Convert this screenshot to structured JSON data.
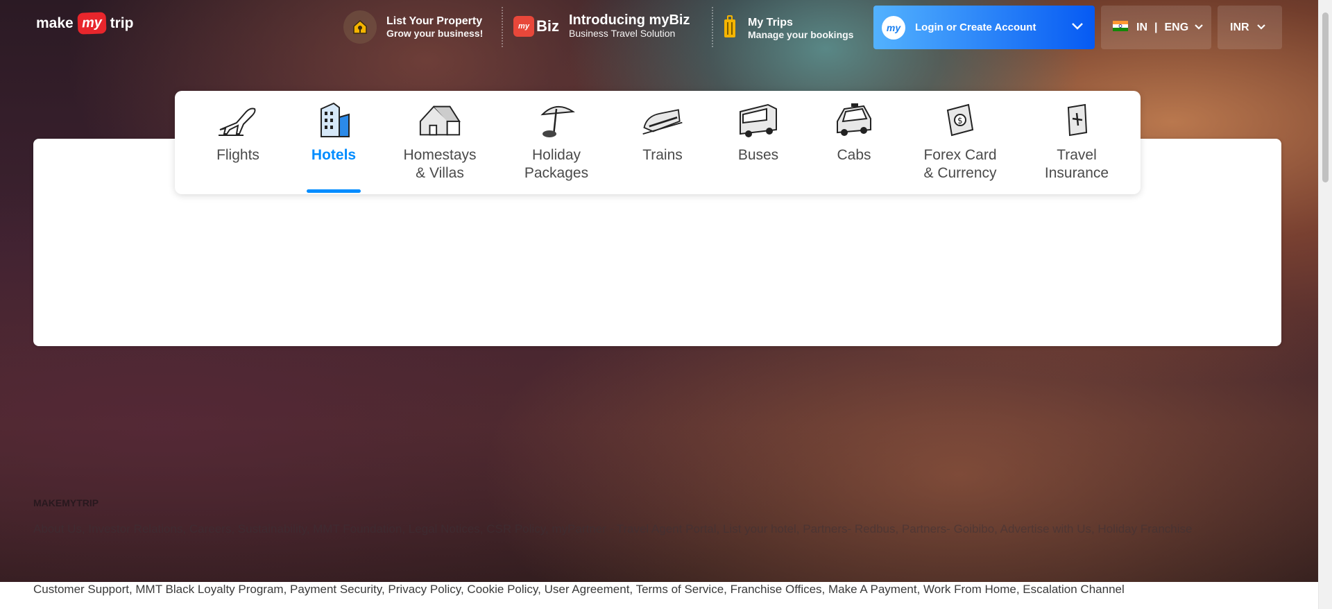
{
  "header": {
    "logo": {
      "make": "make",
      "my": "my",
      "trip": "trip"
    },
    "list_property": {
      "title": "List Your Property",
      "subtitle": "Grow your business!"
    },
    "mybiz": {
      "badge": "Biz",
      "title": "Introducing myBiz",
      "subtitle": "Business Travel Solution"
    },
    "my_trips": {
      "title": "My Trips",
      "subtitle": "Manage your bookings"
    },
    "login": {
      "avatar": "my",
      "label": "Login or Create Account"
    },
    "region": {
      "country": "IN",
      "divider": "|",
      "language": "ENG"
    },
    "currency": {
      "label": "INR"
    }
  },
  "nav": {
    "items": [
      {
        "label": "Flights",
        "icon": "plane-icon",
        "active": false
      },
      {
        "label": "Hotels",
        "icon": "hotel-building-icon",
        "active": true
      },
      {
        "label": "Homestays\n& Villas",
        "icon": "house-icon",
        "active": false
      },
      {
        "label": "Holiday\nPackages",
        "icon": "umbrella-icon",
        "active": false
      },
      {
        "label": "Trains",
        "icon": "train-icon",
        "active": false
      },
      {
        "label": "Buses",
        "icon": "bus-icon",
        "active": false
      },
      {
        "label": "Cabs",
        "icon": "car-icon",
        "active": false
      },
      {
        "label": "Forex Card\n& Currency",
        "icon": "forex-card-icon",
        "active": false
      },
      {
        "label": "Travel\nInsurance",
        "icon": "insurance-icon",
        "active": false
      }
    ]
  },
  "footer": {
    "title": "MAKEMYTRIP",
    "links_row1": "About Us, Investor Relations, Careers, Sustainability, MMT Foundation, Legal Notices, CSR Policy, myPartner - Travel Agent Portal, List your hotel, Partners- Redbus, Partners- Goibibo, Advertise with Us, Holiday Franchise",
    "links_row2": "Customer Support, MMT Black Loyalty Program, Payment Security, Privacy Policy, Cookie Policy, User Agreement, Terms of Service, Franchise Offices, Make A Payment, Work From Home, Escalation Channel"
  },
  "colors": {
    "accent": "#008cff",
    "login_start": "#53b2fe",
    "login_end": "#065af3",
    "brand_red": "#e8262c"
  }
}
